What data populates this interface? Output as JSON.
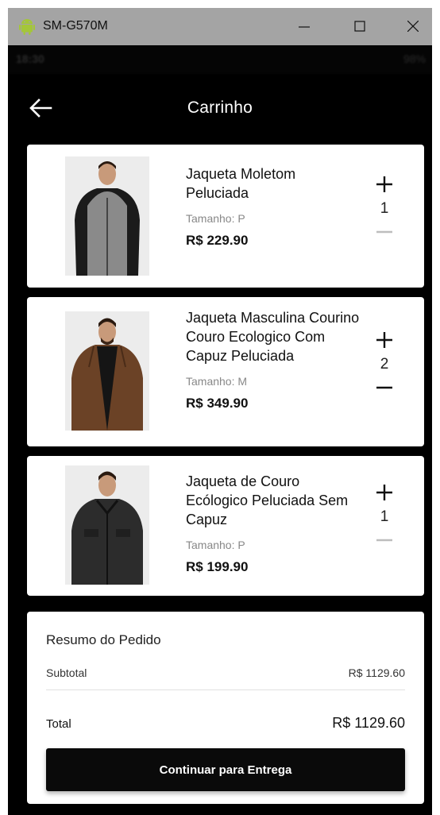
{
  "window": {
    "title": "SM-G570M",
    "icon": "android-icon"
  },
  "status_bar": {
    "left": "18:30",
    "right": "98%"
  },
  "appbar": {
    "title": "Carrinho",
    "back_icon": "arrow-back-icon"
  },
  "cart": {
    "items": [
      {
        "name": "Jaqueta Moletom Peluciada",
        "size": "Tamanho: P",
        "price": "R$ 229.90",
        "quantity": "1"
      },
      {
        "name": "Jaqueta Masculina Courino Couro Ecologico Com Capuz Peluciada",
        "size": "Tamanho: M",
        "price": "R$ 349.90",
        "quantity": "2"
      },
      {
        "name": "Jaqueta de Couro Ecólogico Peluciada Sem Capuz",
        "size": "Tamanho: P",
        "price": "R$ 199.90",
        "quantity": "1"
      }
    ]
  },
  "summary": {
    "title": "Resumo do Pedido",
    "subtotal_label": "Subtotal",
    "subtotal_value": "R$ 1129.60",
    "total_label": "Total",
    "total_value": "R$ 1129.60",
    "button_label": "Continuar para Entrega"
  },
  "colors": {
    "window_titlebar": "#a4a4a4",
    "android_green": "#a4c639",
    "background": "#000000",
    "card": "#ffffff",
    "button": "#0a0a0a",
    "minus_disabled": "#bdbdbd"
  }
}
